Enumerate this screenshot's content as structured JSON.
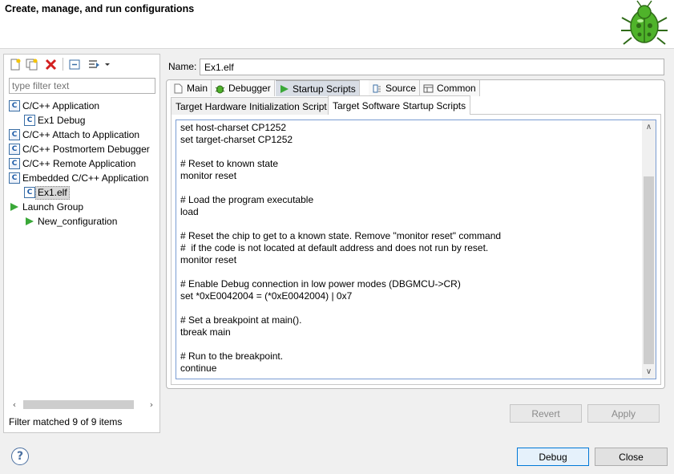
{
  "dialog": {
    "title": "Create, manage, and run configurations"
  },
  "sidebar": {
    "filter_placeholder": "type filter text",
    "items": [
      {
        "label": "C/C++ Application",
        "icon": "c-config-type-icon",
        "level": 0
      },
      {
        "label": "Ex1 Debug",
        "icon": "c-config-icon",
        "level": 1
      },
      {
        "label": "C/C++ Attach to Application",
        "icon": "c-config-type-icon",
        "level": 0
      },
      {
        "label": "C/C++ Postmortem Debugger",
        "icon": "c-config-type-icon",
        "level": 0
      },
      {
        "label": "C/C++ Remote Application",
        "icon": "c-config-type-icon",
        "level": 0
      },
      {
        "label": "Embedded C/C++ Application",
        "icon": "c-config-type-icon",
        "level": 0
      },
      {
        "label": "Ex1.elf",
        "icon": "c-config-icon",
        "level": 1,
        "selected": true
      },
      {
        "label": "Launch Group",
        "icon": "launch-group-icon",
        "level": 0
      },
      {
        "label": "New_configuration",
        "icon": "launch-config-icon",
        "level": 1
      }
    ],
    "status": "Filter matched 9 of 9 items"
  },
  "config": {
    "name_label": "Name:",
    "name_value": "Ex1.elf",
    "tabs": [
      {
        "label": "Main",
        "icon": "main-tab-icon"
      },
      {
        "label": "Debugger",
        "icon": "bug-icon"
      },
      {
        "label": "Startup Scripts",
        "icon": "play-icon",
        "active": true
      },
      {
        "label": "Source",
        "icon": "source-icon"
      },
      {
        "label": "Common",
        "icon": "common-icon"
      }
    ],
    "subtabs": [
      {
        "label": "Target Hardware Initialization Script"
      },
      {
        "label": "Target Software Startup Scripts",
        "active": true
      }
    ],
    "script": "set host-charset CP1252\nset target-charset CP1252\n\n# Reset to known state\nmonitor reset\n\n# Load the program executable\nload\n\n# Reset the chip to get to a known state. Remove \"monitor reset\" command\n#  if the code is not located at default address and does not run by reset.\nmonitor reset\n\n# Enable Debug connection in low power modes (DBGMCU->CR)\nset *0xE0042004 = (*0xE0042004) | 0x7\n\n# Set a breakpoint at main().\ntbreak main\n\n# Run to the breakpoint.\ncontinue"
  },
  "buttons": {
    "revert": "Revert",
    "apply": "Apply",
    "debug": "Debug",
    "close": "Close",
    "help": "?"
  },
  "colors": {
    "accent": "#0078d7",
    "selection": "#d9d9d9",
    "play_green": "#3aa838"
  }
}
